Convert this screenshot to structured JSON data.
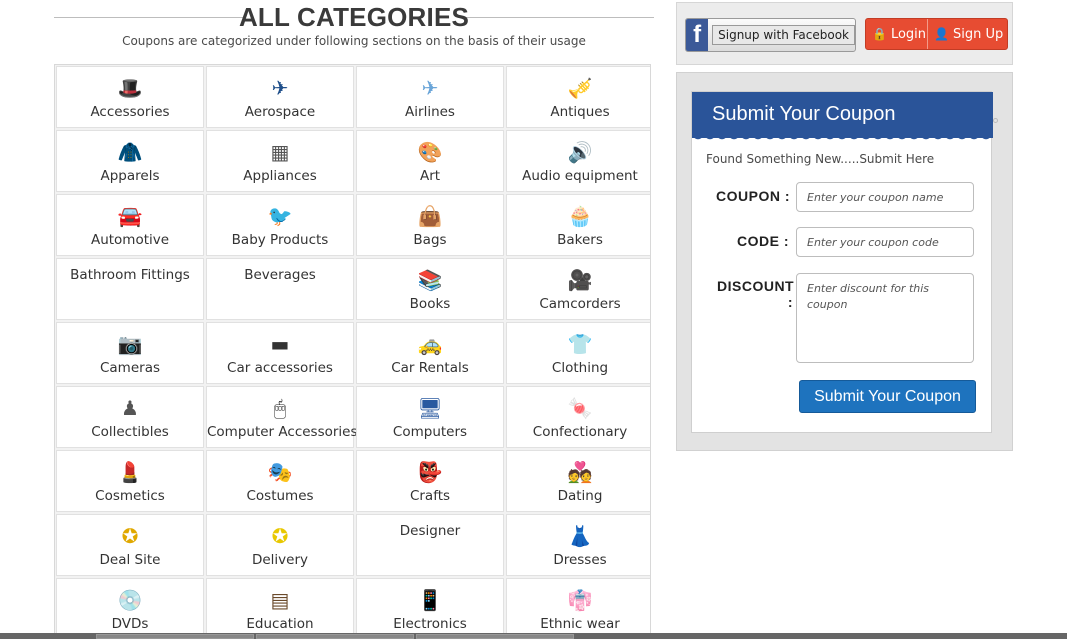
{
  "header": {
    "title": "ALL CATEGORIES",
    "subtitle": "Coupons are categorized under following sections on the basis of their usage"
  },
  "categories": [
    {
      "label": "Accessories",
      "icon": "hat-icon",
      "glyph": "🎩",
      "color": "#7a1e1e"
    },
    {
      "label": "Aerospace",
      "icon": "airplane-icon",
      "glyph": "✈",
      "color": "#1f4f8a"
    },
    {
      "label": "Airlines",
      "icon": "jet-icon",
      "glyph": "✈",
      "color": "#6aa5d8"
    },
    {
      "label": "Antiques",
      "icon": "gramophone-icon",
      "glyph": "🎺",
      "color": "#b08a2e"
    },
    {
      "label": "Apparels",
      "icon": "jacket-icon",
      "glyph": "🧥",
      "color": "#222222"
    },
    {
      "label": "Appliances",
      "icon": "stove-icon",
      "glyph": "▦",
      "color": "#555555"
    },
    {
      "label": "Art",
      "icon": "palette-icon",
      "glyph": "🎨",
      "color": "#8a5a2b"
    },
    {
      "label": "Audio equipment",
      "icon": "speaker-icon",
      "glyph": "🔊",
      "color": "#111111"
    },
    {
      "label": "Automotive",
      "icon": "car-icon",
      "glyph": "🚘",
      "color": "#222222"
    },
    {
      "label": "Baby Products",
      "icon": "stork-icon",
      "glyph": "🐦",
      "color": "#3aa0c8"
    },
    {
      "label": "Bags",
      "icon": "bag-icon",
      "glyph": "👜",
      "color": "#5a9fd4"
    },
    {
      "label": "Bakers",
      "icon": "cupcake-icon",
      "glyph": "🧁",
      "color": "#7a3fa0"
    },
    {
      "label": "Bathroom Fittings",
      "icon": "",
      "glyph": "",
      "color": ""
    },
    {
      "label": "Beverages",
      "icon": "",
      "glyph": "",
      "color": ""
    },
    {
      "label": "Books",
      "icon": "books-icon",
      "glyph": "📚",
      "color": "#333333"
    },
    {
      "label": "Camcorders",
      "icon": "camcorder-icon",
      "glyph": "🎥",
      "color": "#444444"
    },
    {
      "label": "Cameras",
      "icon": "camera-icon",
      "glyph": "📷",
      "color": "#222222"
    },
    {
      "label": "Car accessories",
      "icon": "car-stereo-icon",
      "glyph": "▬",
      "color": "#333333"
    },
    {
      "label": "Car Rentals",
      "icon": "hire-car-icon",
      "glyph": "🚕",
      "color": "#c9a400"
    },
    {
      "label": "Clothing",
      "icon": "shirt-icon",
      "glyph": "👕",
      "color": "#3a8fd8"
    },
    {
      "label": "Collectibles",
      "icon": "collectibles-icon",
      "glyph": "♟",
      "color": "#555555"
    },
    {
      "label": "Computer Accessories",
      "icon": "mouse-icon",
      "glyph": "🖱",
      "color": "#222222"
    },
    {
      "label": "Computers",
      "icon": "computer-icon",
      "glyph": "🖥",
      "color": "#2a5aa0"
    },
    {
      "label": "Confectionary",
      "icon": "candy-bag-icon",
      "glyph": "🍬",
      "color": "#3a9a3a"
    },
    {
      "label": "Cosmetics",
      "icon": "lipstick-icon",
      "glyph": "💄",
      "color": "#c0203a"
    },
    {
      "label": "Costumes",
      "icon": "costume-icon",
      "glyph": "🎭",
      "color": "#6a2a8a"
    },
    {
      "label": "Crafts",
      "icon": "mask-icon",
      "glyph": "👺",
      "color": "#8a4a1a"
    },
    {
      "label": "Dating",
      "icon": "dating-icon",
      "glyph": "💑",
      "color": "#8a1a8a"
    },
    {
      "label": "Deal Site",
      "icon": "offer-badge-icon",
      "glyph": "✪",
      "color": "#e0a800"
    },
    {
      "label": "Delivery",
      "icon": "free-delivery-icon",
      "glyph": "✪",
      "color": "#e8c800"
    },
    {
      "label": "Designer",
      "icon": "",
      "glyph": "",
      "color": ""
    },
    {
      "label": "Dresses",
      "icon": "dress-icon",
      "glyph": "👗",
      "color": "#b02020"
    },
    {
      "label": "DVDs",
      "icon": "dvd-icon",
      "glyph": "💿",
      "color": "#1a60c0"
    },
    {
      "label": "Education",
      "icon": "chalkboard-icon",
      "glyph": "▤",
      "color": "#6a4a2a"
    },
    {
      "label": "Electronics",
      "icon": "phone-icon",
      "glyph": "📱",
      "color": "#333333"
    },
    {
      "label": "Ethnic wear",
      "icon": "ethnic-dress-icon",
      "glyph": "👘",
      "color": "#2a8a6a"
    }
  ],
  "social": {
    "facebook_label": "Signup with Facebook",
    "login_label": "Login",
    "signup_label": "Sign Up"
  },
  "coupon_form": {
    "title": "Submit Your Coupon",
    "intro": "Found Something New.....Submit Here",
    "coupon_label": "COUPON :",
    "coupon_placeholder": "Enter your coupon name",
    "code_label": "CODE :",
    "code_placeholder": "Enter your coupon code",
    "discount_label": "DISCOUNT :",
    "discount_placeholder": "Enter discount for this coupon",
    "submit_label": "Submit Your Coupon"
  },
  "colors": {
    "brand_blue": "#2a5499",
    "facebook": "#3b5998",
    "auth_red": "#e74c32",
    "submit_blue": "#1e73be"
  }
}
